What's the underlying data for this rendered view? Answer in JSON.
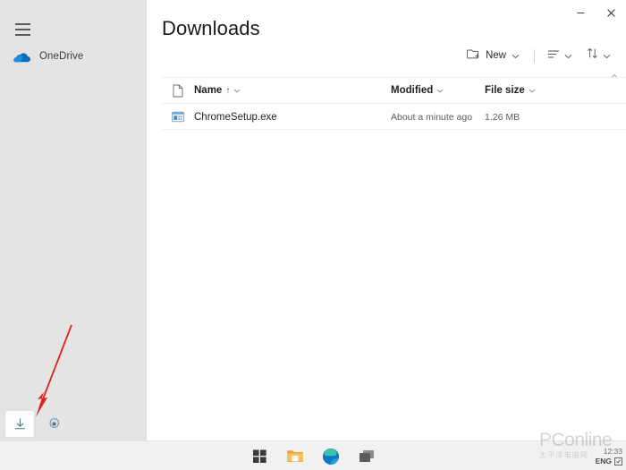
{
  "window": {
    "title": "Downloads",
    "controls": [
      {
        "name": "minimize",
        "glyph": "minimize-icon"
      },
      {
        "name": "close",
        "glyph": "close-icon"
      }
    ]
  },
  "sidebar": {
    "menu_icon": "hamburger-icon",
    "items": [
      {
        "label": "OneDrive",
        "icon": "onedrive-cloud-icon"
      }
    ],
    "bottom_buttons": [
      {
        "name": "downloads",
        "icon": "download-icon",
        "active": true
      },
      {
        "name": "settings",
        "icon": "gear-icon",
        "active": false
      }
    ]
  },
  "toolbar": {
    "new_label": "New",
    "new_icon": "new-folder-icon",
    "buttons": [
      {
        "name": "view-layout",
        "icon": "view-list-icon"
      },
      {
        "name": "sort",
        "icon": "sort-arrows-icon"
      }
    ],
    "collapse_icon": "chevron-up-icon"
  },
  "table": {
    "columns": [
      {
        "key": "icon",
        "label": ""
      },
      {
        "key": "name",
        "label": "Name",
        "sort": "↑"
      },
      {
        "key": "modified",
        "label": "Modified",
        "sort": ""
      },
      {
        "key": "size",
        "label": "File size",
        "sort": ""
      }
    ],
    "rows": [
      {
        "icon": "exe-file-icon",
        "name": "ChromeSetup.exe",
        "modified": "About a minute ago",
        "size": "1.26 MB"
      }
    ]
  },
  "annotation": {
    "type": "red-arrow",
    "color": "#e02020",
    "points_to": "downloads-button"
  },
  "taskbar": {
    "buttons": [
      {
        "name": "start",
        "icon": "windows-logo-icon"
      },
      {
        "name": "file-explorer",
        "icon": "folder-icon"
      },
      {
        "name": "microsoft-edge",
        "icon": "edge-icon"
      },
      {
        "name": "task-view",
        "icon": "task-view-icon"
      }
    ],
    "tray": {
      "time": "12:33",
      "language": "ENG",
      "ime_icon": "ime-icon",
      "popup_icon": "stacked-disks-icon",
      "popup_chevron": "chevron-down-icon"
    }
  },
  "watermark": {
    "main": "PConline",
    "sub": "太平洋电脑网"
  },
  "colors": {
    "sidebar_bg": "#e4e4e4",
    "main_bg": "#ffffff",
    "taskbar_bg": "#f1f1f1",
    "accent_blue": "#0f78d4",
    "annotation_red": "#e02020",
    "text_primary": "#1f1f1f",
    "text_secondary": "#5d5d5d"
  }
}
